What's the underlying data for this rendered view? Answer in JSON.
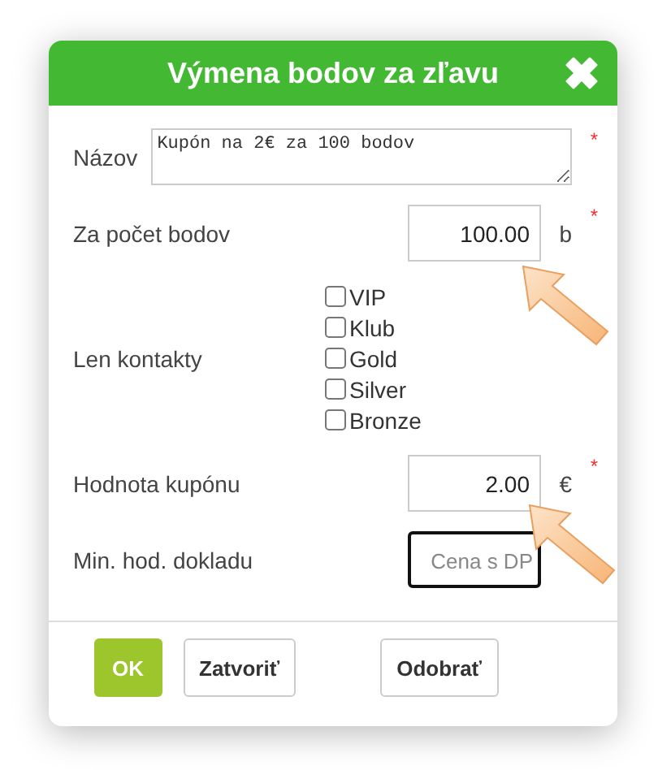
{
  "dialog": {
    "title": "Výmena bodov za zľavu",
    "fields": [
      {
        "kind": "textarea",
        "label": "Názov",
        "value": "Kupón na 2€ za 100 bodov",
        "required_mark": "*"
      },
      {
        "kind": "number",
        "label": "Za počet bodov",
        "value": "100.00",
        "unit": "b",
        "required_mark": "*"
      },
      {
        "kind": "checkboxes",
        "label": "Len kontakty",
        "options": [
          {
            "label": "VIP",
            "checked": false
          },
          {
            "label": "Klub",
            "checked": false
          },
          {
            "label": "Gold",
            "checked": false
          },
          {
            "label": "Silver",
            "checked": false
          },
          {
            "label": "Bronze",
            "checked": false
          }
        ]
      },
      {
        "kind": "number",
        "label": "Hodnota kupónu",
        "value": "2.00",
        "unit": "€",
        "required_mark": "*"
      },
      {
        "kind": "number",
        "label": "Min. hod. dokladu",
        "placeholder": "Cena s DP",
        "focused": true
      }
    ],
    "buttons": [
      {
        "label": "OK",
        "kind": "primary"
      },
      {
        "label": "Zatvoriť",
        "kind": "secondary"
      },
      {
        "label": "Odobrať",
        "kind": "secondary"
      }
    ]
  }
}
